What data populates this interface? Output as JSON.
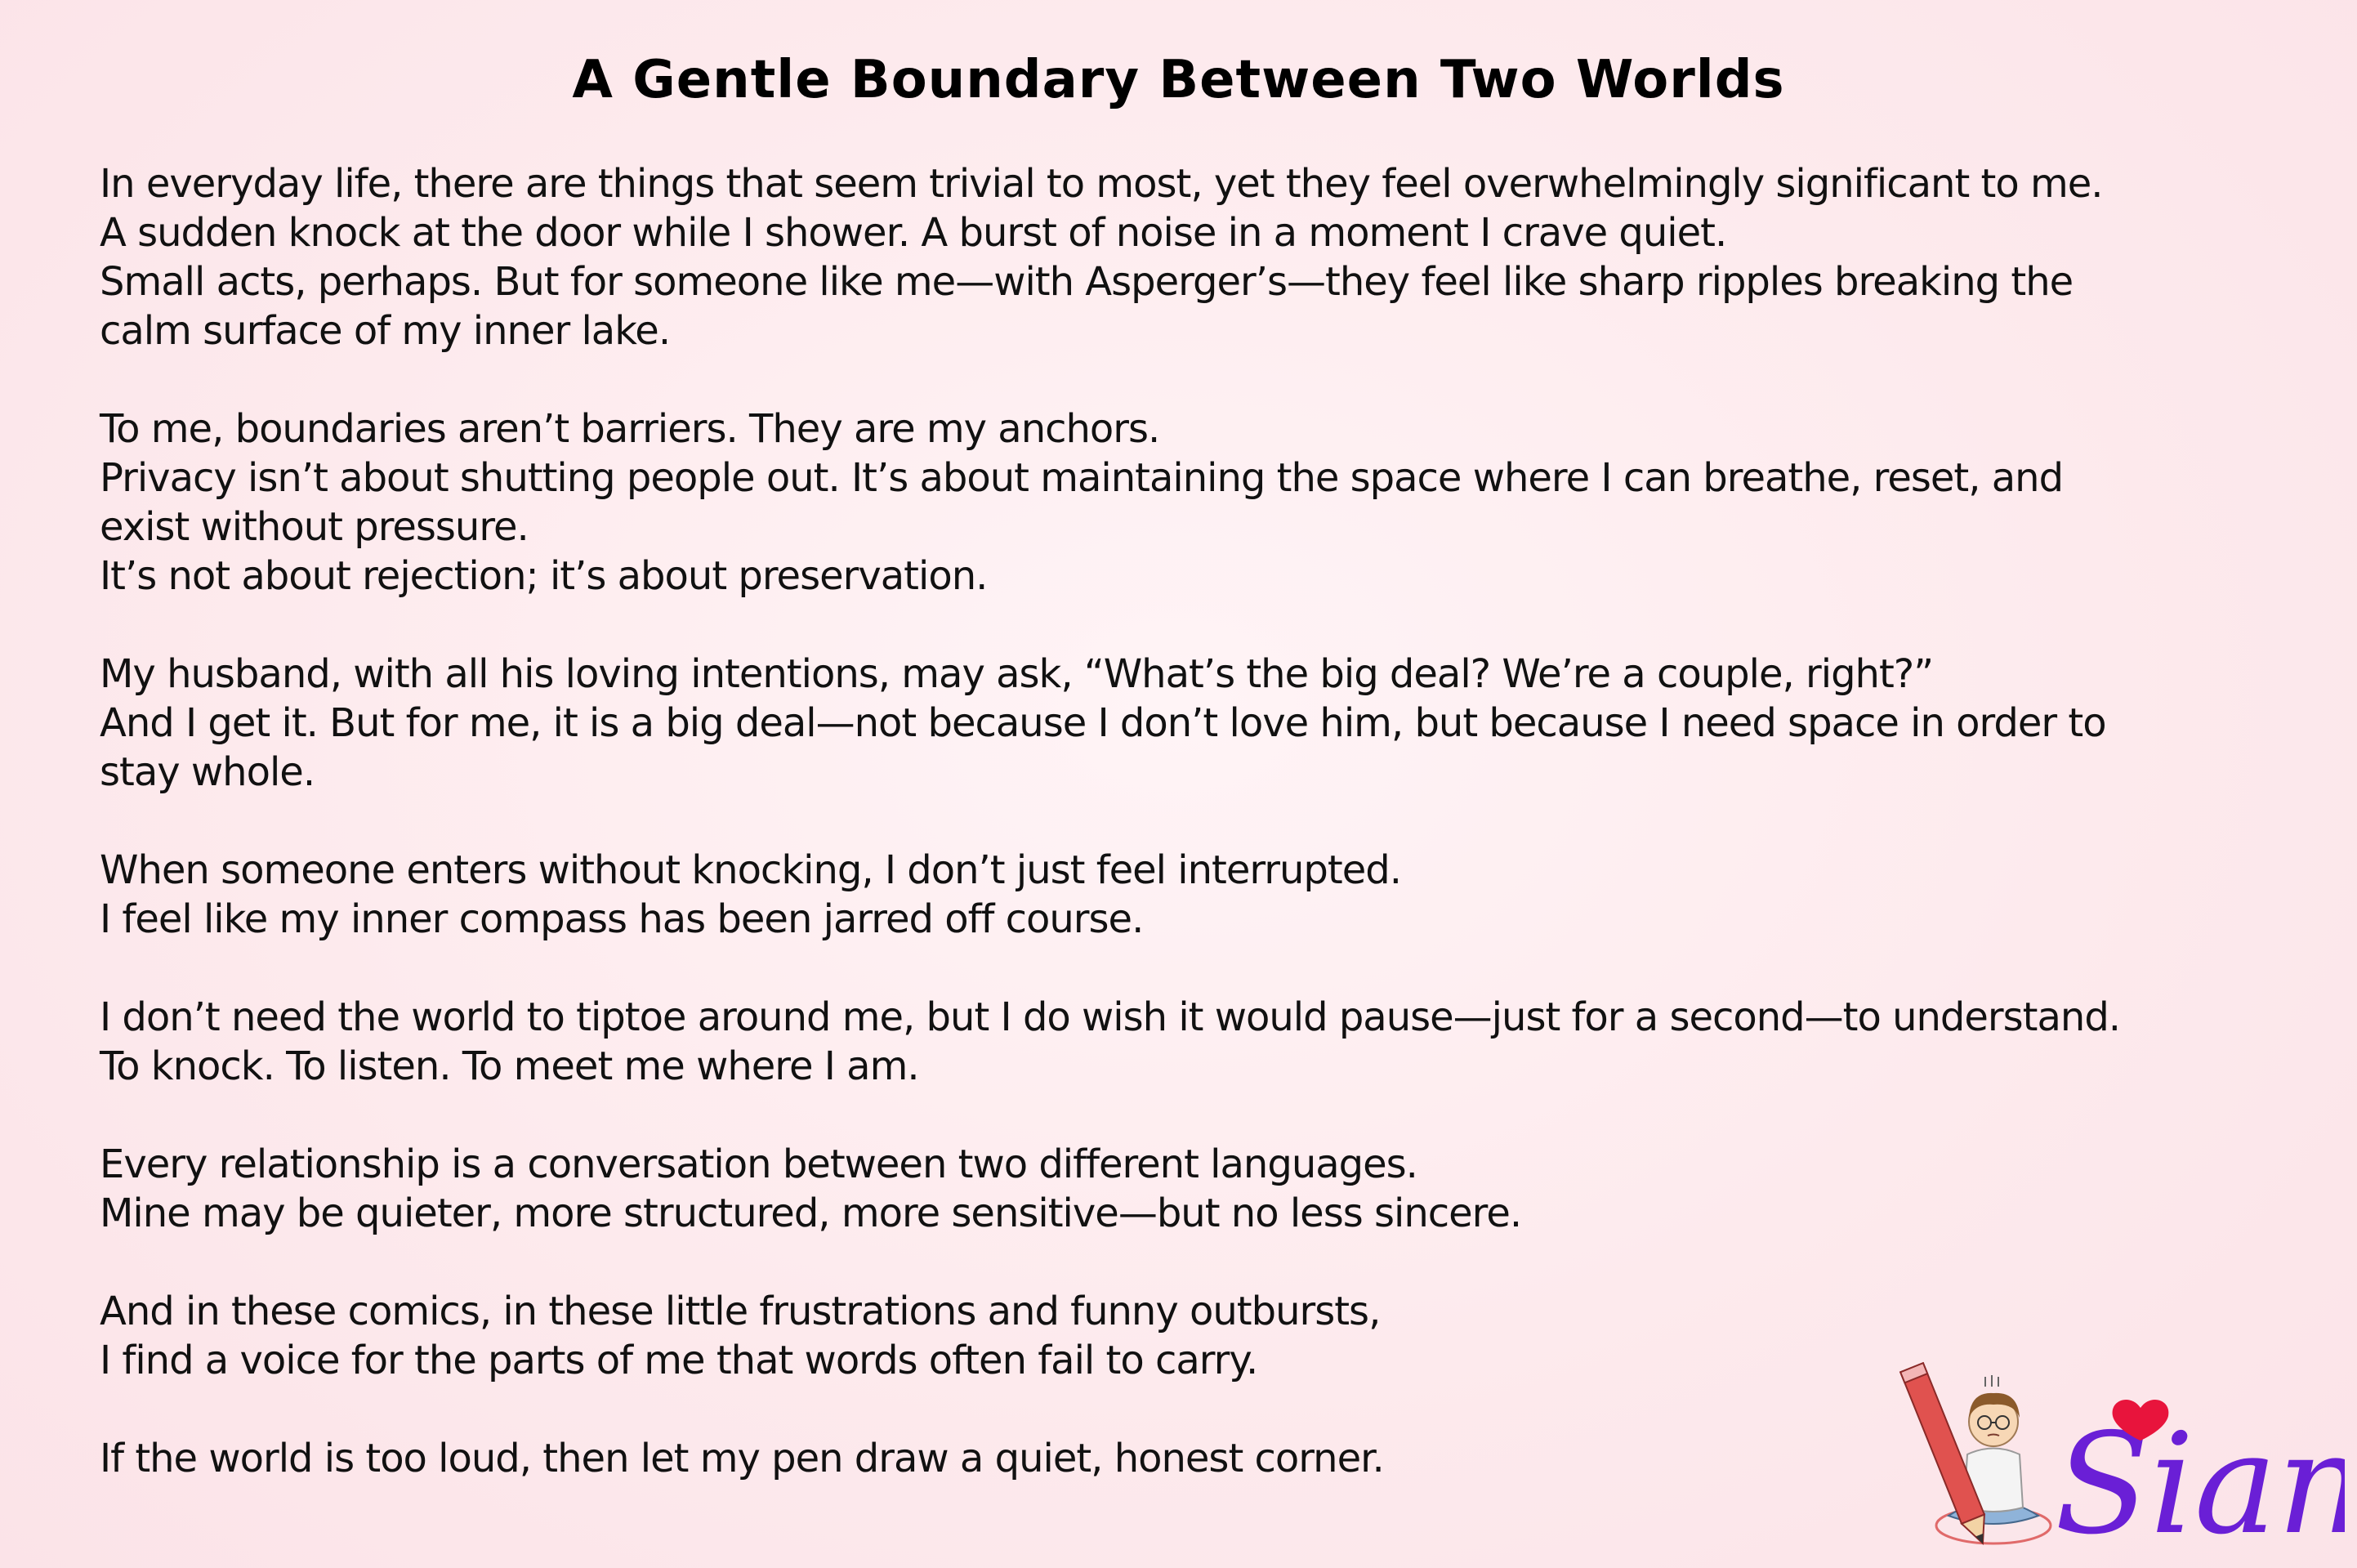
{
  "title": "A Gentle Boundary Between Two Worlds",
  "paragraphs": [
    {
      "lines": [
        "In everyday life, there are things that seem trivial to most, yet they feel overwhelmingly significant to me.",
        "A sudden knock at the door while I shower. A burst of noise in a moment I crave quiet.",
        "Small acts, perhaps. But for someone like me—with Asperger’s—they feel like sharp ripples breaking the",
        "calm surface of my inner lake."
      ]
    },
    {
      "lines": [
        "To me, boundaries aren’t barriers. They are my anchors.",
        "Privacy isn’t about shutting people out. It’s about maintaining the space where I can breathe, reset, and",
        "exist without pressure.",
        "It’s not about rejection; it’s about preservation."
      ]
    },
    {
      "lines": [
        "My husband, with all his loving intentions, may ask, “What’s the big deal? We’re a couple, right?”",
        "And I get it. But for me, it is a big deal—not because I don’t love him, but because I need space in order to",
        "stay whole."
      ]
    },
    {
      "lines": [
        "When someone enters without knocking, I don’t just feel interrupted.",
        "I feel like my inner compass has been jarred off course."
      ]
    },
    {
      "lines": [
        "I don’t need the world to tiptoe around me, but I do wish it would pause—just for a second—to understand.",
        "To knock. To listen. To meet me where I am."
      ]
    },
    {
      "lines": [
        "Every relationship is a conversation between two different languages.",
        "Mine may be quieter, more structured, more sensitive—but no less sincere."
      ]
    },
    {
      "lines": [
        "And in these comics, in these little frustrations and funny outbursts,",
        "I find a voice for the parts of me that words often fail to carry."
      ]
    },
    {
      "lines": [
        "If the world is too loud, then let my pen draw a quiet, honest corner."
      ]
    }
  ],
  "signature": {
    "name": "Sian",
    "icon": "artist-with-pencil-icon",
    "heart_icon": "heart-icon",
    "name_color": "#6a1fd6",
    "heart_color": "#e8143c"
  }
}
